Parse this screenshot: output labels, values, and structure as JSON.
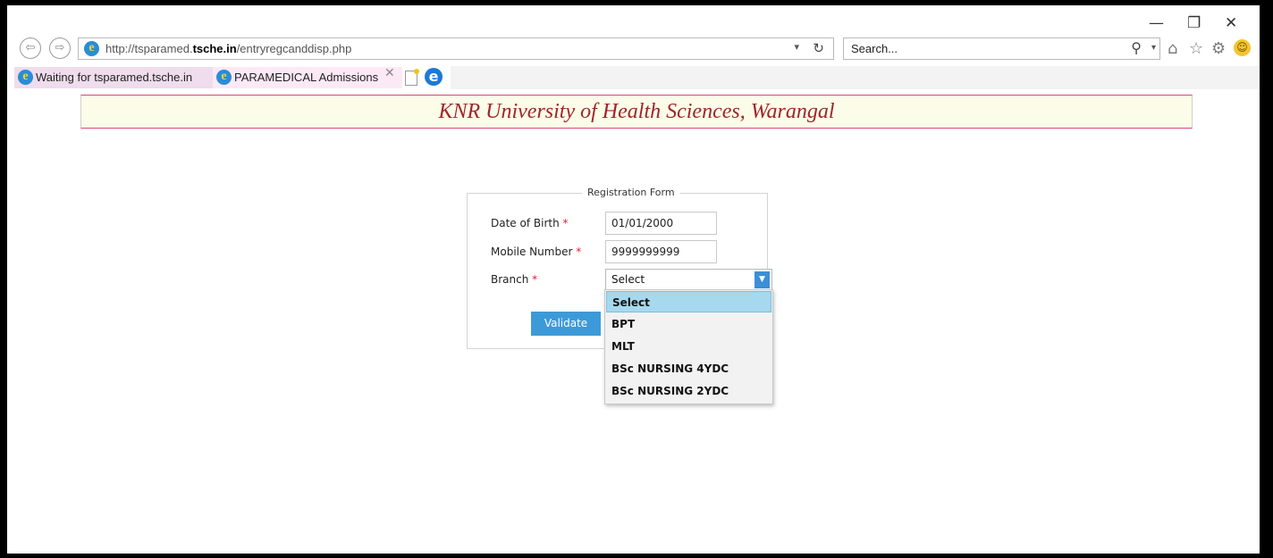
{
  "browser": {
    "address_url_prefix": "http://tsparamed.",
    "address_url_domain": "tsche.in",
    "address_url_path": "/entryregcanddisp.php",
    "search_placeholder": "Search...",
    "window_controls": {
      "minimize": "—",
      "restore": "❐",
      "close": "✕"
    },
    "tabs": [
      {
        "label": "Waiting for tsparamed.tsche.in",
        "active": false
      },
      {
        "label": "PARAMEDICAL Admissions",
        "active": true
      }
    ],
    "tab_close_glyph": "✕"
  },
  "page": {
    "banner_title": "KNR University of Health Sciences, Warangal",
    "form": {
      "legend": "Registration Form",
      "fields": [
        {
          "label": "Date of Birth",
          "required_mark": "*",
          "value": "01/01/2000"
        },
        {
          "label": "Mobile Number",
          "required_mark": "*",
          "value": "9999999999"
        },
        {
          "label": "Branch",
          "required_mark": "*",
          "value": "Select"
        }
      ],
      "validate_label": "Validate",
      "branch_options": [
        "Select",
        "BPT",
        "MLT",
        "BSc NURSING 4YDC",
        "BSc NURSING 2YDC"
      ],
      "branch_highlighted": "Select"
    }
  },
  "colors": {
    "banner_text": "#a0242b",
    "banner_bg": "#fbfde8",
    "accent_blue": "#3d9ad9",
    "required": "#e0203a",
    "option_highlight": "#a6d9ee"
  }
}
